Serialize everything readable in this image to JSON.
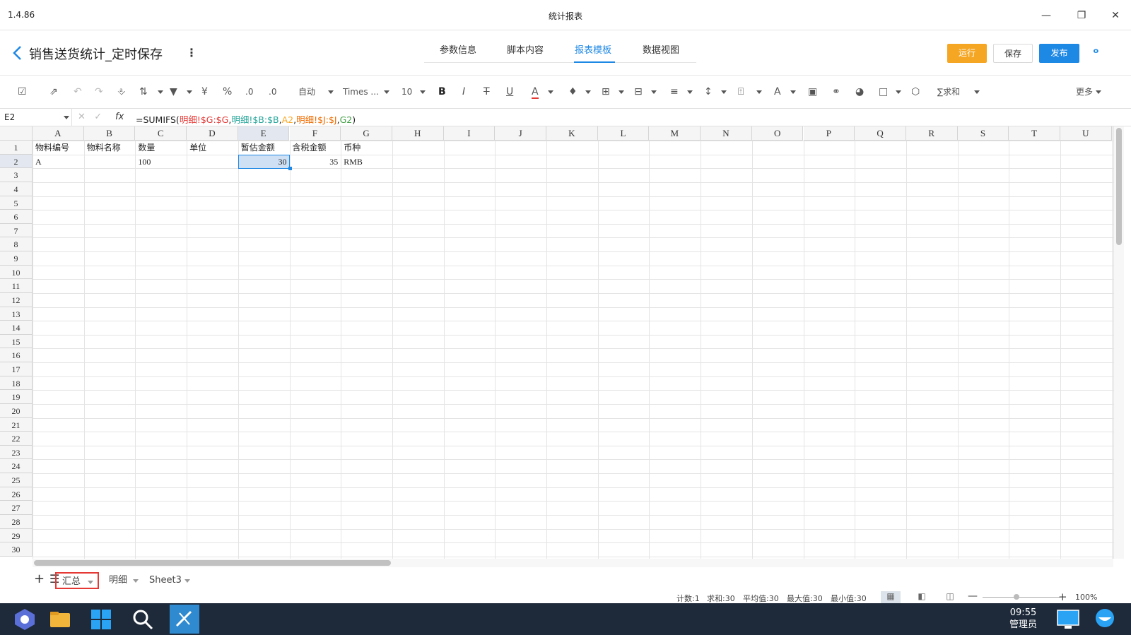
{
  "window": {
    "version": "1.4.86",
    "title": "统计报表"
  },
  "header": {
    "report_title": "销售送货统计_定时保存",
    "tabs": [
      "参数信息",
      "脚本内容",
      "报表模板",
      "数据视图"
    ],
    "active_tab": "报表模板",
    "buttons": {
      "run": "运行",
      "save": "保存",
      "publish": "发布"
    },
    "colors": {
      "run": "#f5a623",
      "publish": "#1e88e5",
      "accent": "#1e88e5"
    }
  },
  "toolbar": {
    "auto_label": "自动",
    "font_name": "Times ...",
    "font_size": "10",
    "currency": "¥",
    "percent": "%",
    "sum_label": "∑求和",
    "more_label": "更多"
  },
  "formula_bar": {
    "cell_ref": "E2",
    "fx": "fx",
    "formula_parts": [
      {
        "t": "=SUMIFS(",
        "c": "plain"
      },
      {
        "t": "明细!$G:$G",
        "c": "red"
      },
      {
        "t": ",",
        "c": "plain"
      },
      {
        "t": "明细!$B:$B",
        "c": "teal"
      },
      {
        "t": ",",
        "c": "plain"
      },
      {
        "t": "A2",
        "c": "yel"
      },
      {
        "t": ",",
        "c": "plain"
      },
      {
        "t": "明细!$J:$J",
        "c": "org"
      },
      {
        "t": ",",
        "c": "plain"
      },
      {
        "t": "G2",
        "c": "grn"
      },
      {
        "t": ")",
        "c": "plain"
      }
    ]
  },
  "sheet": {
    "columns": [
      "A",
      "B",
      "C",
      "D",
      "E",
      "F",
      "G",
      "H",
      "I",
      "J",
      "K",
      "L",
      "M",
      "N",
      "O",
      "P",
      "Q",
      "R",
      "S",
      "T",
      "U"
    ],
    "selected_column": "E",
    "selected_row": 2,
    "row_count": 30,
    "header_row": [
      "物料编号",
      "物料名称",
      "数量",
      "单位",
      "暂估金额",
      "含税金额",
      "币种"
    ],
    "data_row": [
      "A",
      "",
      "100",
      "",
      "30",
      "35",
      "RMB"
    ]
  },
  "sheet_tabs": {
    "tabs": [
      "汇总",
      "明细",
      "Sheet3"
    ],
    "active": "汇总"
  },
  "status_bar": {
    "count": "计数:1",
    "sum": "求和:30",
    "avg": "平均值:30",
    "max": "最大值:30",
    "min": "最小值:30",
    "zoom": "100%"
  },
  "taskbar": {
    "time": "09:55",
    "user": "管理员"
  }
}
